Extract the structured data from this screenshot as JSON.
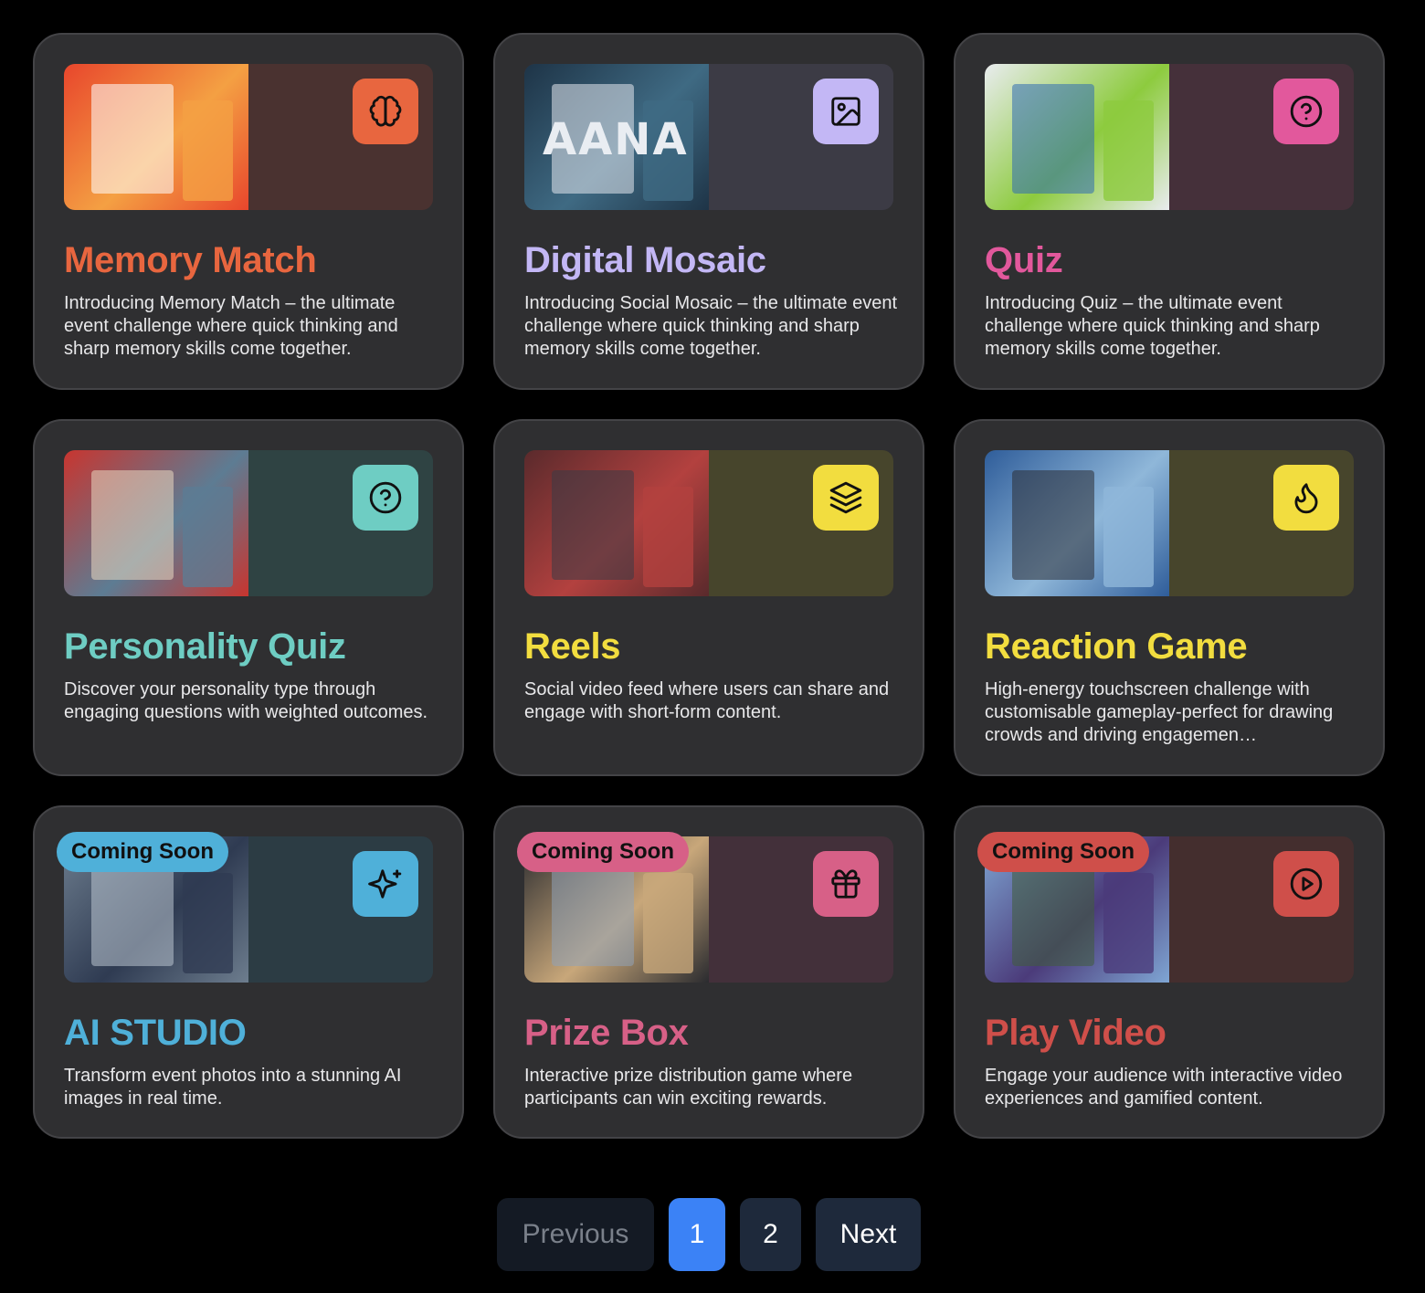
{
  "cards": [
    {
      "title": "Memory Match",
      "description": "Introducing Memory Match – the ultimate event challenge where quick thinking and sharp memory skills come together.",
      "icon": "brain-icon",
      "accent": "#e8663f",
      "panel": "#4a3230",
      "photo_colors": [
        "#e8462c",
        "#f4a043",
        "#ffffff"
      ],
      "badge": ""
    },
    {
      "title": "Digital Mosaic",
      "description": "Introducing Social Mosaic – the ultimate event challenge where quick thinking and sharp memory skills come together.",
      "icon": "image-icon",
      "accent": "#c3b7f5",
      "panel": "#3c3b45",
      "photo_colors": [
        "#1e3447",
        "#3f6a83",
        "#e3e8ee"
      ],
      "photo_text": "AANA",
      "badge": ""
    },
    {
      "title": "Quiz",
      "description": "Introducing Quiz – the ultimate event challenge where quick thinking and sharp memory skills come together.",
      "icon": "question-icon",
      "accent": "#e2589c",
      "panel": "#45303a",
      "photo_colors": [
        "#e9ecef",
        "#8dcb3e",
        "#2f6bb3"
      ],
      "badge": ""
    },
    {
      "title": "Personality Quiz",
      "description": "Discover your personality type through engaging questions with weighted outcomes.",
      "icon": "question-icon",
      "accent": "#6ecdc3",
      "panel": "#2f4343",
      "photo_colors": [
        "#c8352f",
        "#5d7c93",
        "#e9d8c1"
      ],
      "badge": ""
    },
    {
      "title": "Reels",
      "description": "Social video feed where users can share and engage with short-form content.",
      "icon": "layers-icon",
      "accent": "#f2dd3f",
      "panel": "#47452c",
      "photo_colors": [
        "#5a2a2c",
        "#b3413f",
        "#3a3a45"
      ],
      "badge": ""
    },
    {
      "title": "Reaction Game",
      "description": "High-energy touchscreen challenge with customisable gameplay-perfect for drawing crowds and driving engagemen…",
      "icon": "flame-icon",
      "accent": "#f2dd3f",
      "panel": "#47452c",
      "photo_colors": [
        "#2f5d9a",
        "#8fb7d9",
        "#2b2d35"
      ],
      "badge": ""
    },
    {
      "title": "AI STUDIO",
      "description": "Transform event photos into a stunning AI images in real time.",
      "icon": "sparkles-icon",
      "accent": "#4fb0d9",
      "panel": "#2c3c44",
      "photo_colors": [
        "#6d7d8e",
        "#2f3b52",
        "#b9c4cf"
      ],
      "badge": "Coming Soon"
    },
    {
      "title": "Prize Box",
      "description": "Interactive prize distribution game where participants can win exciting rewards.",
      "icon": "gift-icon",
      "accent": "#d76087",
      "panel": "#43303a",
      "photo_colors": [
        "#2a2b2f",
        "#c8a77a",
        "#8fa2b8"
      ],
      "badge": "Coming Soon"
    },
    {
      "title": "Play Video",
      "description": "Engage your audience with interactive video experiences and gamified content.",
      "icon": "play-circle-icon",
      "accent": "#cf4f4a",
      "panel": "#442e2e",
      "photo_colors": [
        "#7fa6d4",
        "#4b3b7a",
        "#3f5c3a"
      ],
      "badge": "Coming Soon"
    }
  ],
  "pagination": {
    "previous_label": "Previous",
    "pages": [
      "1",
      "2"
    ],
    "active_page": "1",
    "next_label": "Next"
  }
}
